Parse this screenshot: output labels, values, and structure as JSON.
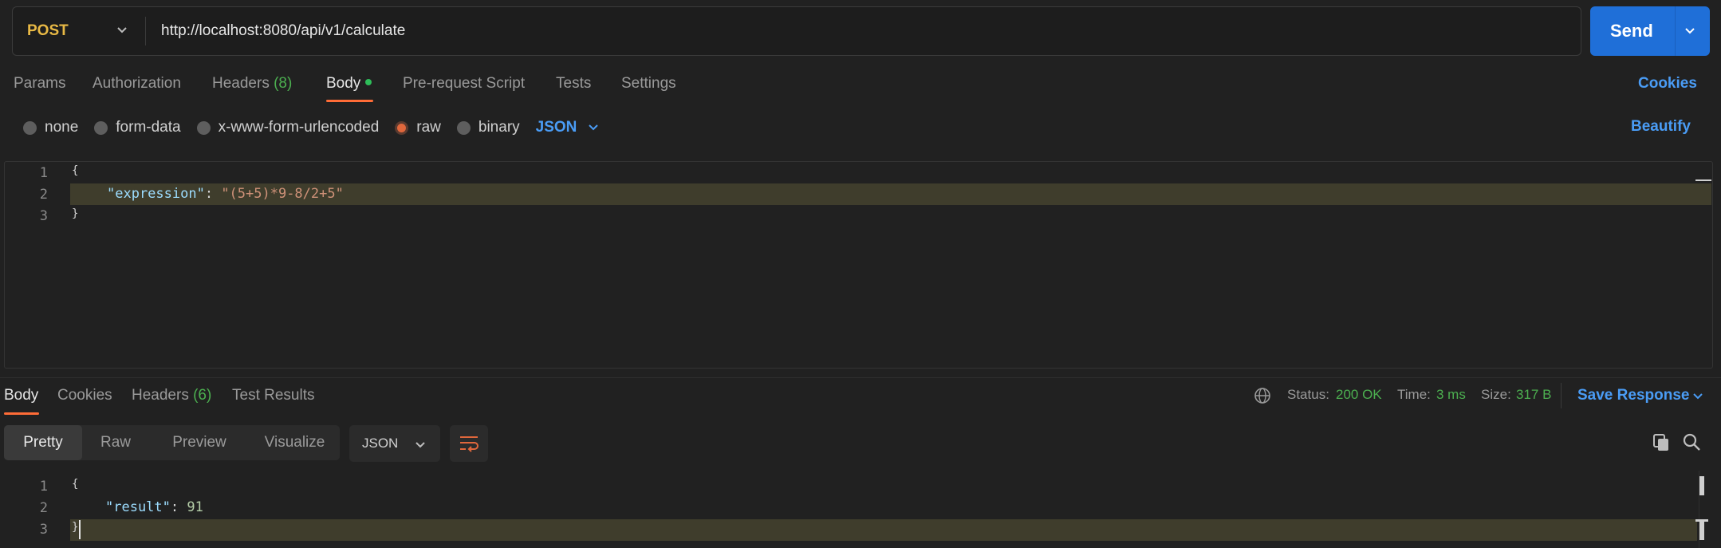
{
  "request": {
    "method": "POST",
    "url": "http://localhost:8080/api/v1/calculate",
    "send_label": "Send"
  },
  "request_tabs": {
    "params": "Params",
    "authorization": "Authorization",
    "headers": "Headers",
    "headers_count": "(8)",
    "body": "Body",
    "prerequest": "Pre-request Script",
    "tests": "Tests",
    "settings": "Settings",
    "cookies": "Cookies"
  },
  "body_types": {
    "none": "none",
    "form_data": "form-data",
    "urlencoded": "x-www-form-urlencoded",
    "raw": "raw",
    "binary": "binary",
    "format": "JSON",
    "beautify": "Beautify",
    "selected": "raw"
  },
  "request_body": {
    "line_numbers": [
      "1",
      "2",
      "3"
    ],
    "open_brace": "{",
    "key": "\"expression\"",
    "colon": ": ",
    "value": "\"(5+5)*9-8/2+5\"",
    "close_brace": "}"
  },
  "response_tabs": {
    "body": "Body",
    "cookies": "Cookies",
    "headers": "Headers",
    "headers_count": "(6)",
    "test_results": "Test Results"
  },
  "response_status": {
    "status_label": "Status:",
    "status_value": "200 OK",
    "time_label": "Time:",
    "time_value": "3 ms",
    "size_label": "Size:",
    "size_value": "317 B",
    "save_response": "Save Response"
  },
  "response_view": {
    "pretty": "Pretty",
    "raw": "Raw",
    "preview": "Preview",
    "visualize": "Visualize",
    "format": "JSON",
    "selected": "Pretty"
  },
  "response_body": {
    "line_numbers": [
      "1",
      "2",
      "3"
    ],
    "open_brace": "{",
    "key": "\"result\"",
    "colon": ": ",
    "value": "91",
    "close_brace": "}"
  },
  "colors": {
    "accent_orange": "#ff6c37",
    "send_blue": "#1f6fd8",
    "link_blue": "#4a9cf5",
    "success_green": "#4caf50",
    "method_post": "#e8b945"
  }
}
